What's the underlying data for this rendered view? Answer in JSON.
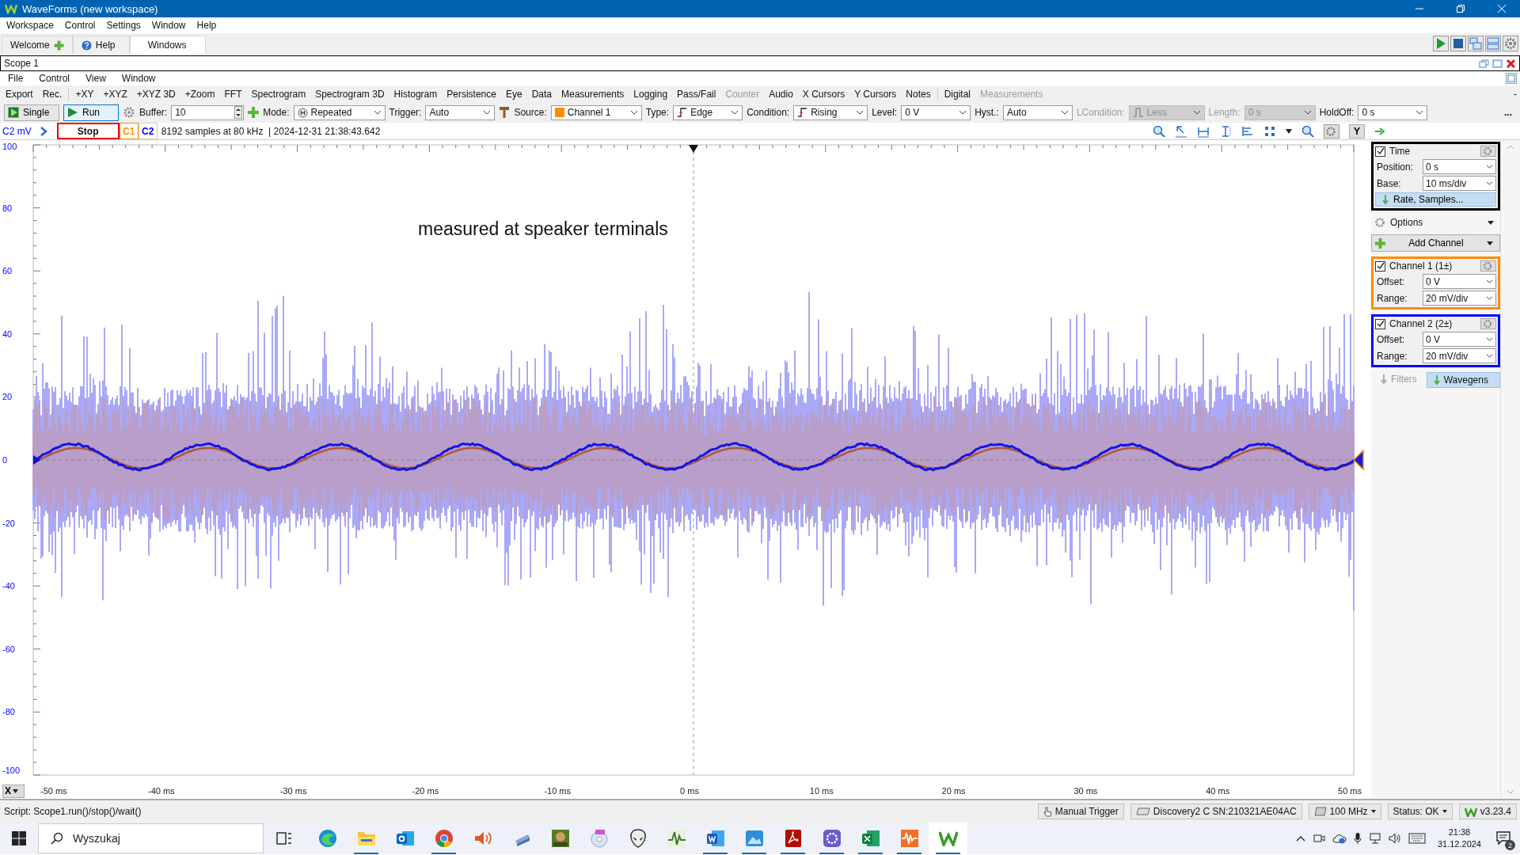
{
  "window": {
    "title": "WaveForms (new workspace)"
  },
  "menu": [
    "Workspace",
    "Control",
    "Settings",
    "Window",
    "Help"
  ],
  "tabs": [
    {
      "label": "Welcome",
      "selected": false
    },
    {
      "label": "Help",
      "selected": false
    },
    {
      "label": "Windows",
      "selected": true
    }
  ],
  "scope": {
    "title": "Scope 1",
    "menu": [
      "File",
      "Control",
      "View",
      "Window"
    ],
    "toolbar": [
      [
        {
          "label": "Export",
          "disabled": false
        },
        {
          "label": "Rec.",
          "disabled": false
        }
      ],
      [
        {
          "label": "+XY",
          "disabled": false
        },
        {
          "label": "+XYZ",
          "disabled": false
        },
        {
          "label": "+XYZ 3D",
          "disabled": false
        },
        {
          "label": "+Zoom",
          "disabled": false
        },
        {
          "label": "FFT",
          "disabled": false
        },
        {
          "label": "Spectrogram",
          "disabled": false
        },
        {
          "label": "Spectrogram 3D",
          "disabled": false
        },
        {
          "label": "Histogram",
          "disabled": false
        },
        {
          "label": "Persistence",
          "disabled": false
        },
        {
          "label": "Eye",
          "disabled": false
        },
        {
          "label": "Data",
          "disabled": false
        },
        {
          "label": "Measurements",
          "disabled": false
        },
        {
          "label": "Logging",
          "disabled": false
        },
        {
          "label": "Pass/Fail",
          "disabled": false
        },
        {
          "label": "Counter",
          "disabled": true
        },
        {
          "label": "Audio",
          "disabled": false
        },
        {
          "label": "X Cursors",
          "disabled": false
        },
        {
          "label": "Y Cursors",
          "disabled": false
        },
        {
          "label": "Notes",
          "disabled": false
        }
      ],
      [
        {
          "label": "Digital",
          "disabled": false
        },
        {
          "label": "Measurements",
          "disabled": true
        }
      ]
    ],
    "toolbar_collapse": "-",
    "trigger_bar": [
      {
        "kind": "button",
        "label": "Single",
        "selected": false
      },
      {
        "kind": "button",
        "label": "Run",
        "selected": true
      },
      {
        "kind": "spin",
        "label": "Buffer:",
        "value": "10"
      },
      {
        "kind": "select",
        "label": "Mode:",
        "value": "Repeated",
        "disabled": false
      },
      {
        "kind": "select",
        "label": "Trigger:",
        "value": "Auto",
        "disabled": false
      },
      {
        "kind": "select",
        "label": "Source:",
        "value": "Channel 1",
        "disabled": false
      },
      {
        "kind": "select",
        "label": "Type:",
        "value": "Edge",
        "disabled": false
      },
      {
        "kind": "select",
        "label": "Condition:",
        "value": "Rising",
        "disabled": false
      },
      {
        "kind": "select",
        "label": "Level:",
        "value": "0 V",
        "disabled": false
      },
      {
        "kind": "select",
        "label": "Hyst.:",
        "value": "Auto",
        "disabled": false
      },
      {
        "kind": "select",
        "label": "LCondition:",
        "value": "Less",
        "disabled": true
      },
      {
        "kind": "select",
        "label": "Length:",
        "value": "0 s",
        "disabled": true
      },
      {
        "kind": "select",
        "label": "HoldOff:",
        "value": "0 s",
        "disabled": false
      },
      {
        "kind": "more",
        "label": "..."
      }
    ],
    "info": {
      "unit": "C2 mV",
      "state": "Stop",
      "channels": [
        {
          "label": "C1",
          "color": "#ff8c00"
        },
        {
          "label": "C2",
          "color": "#0000ff"
        }
      ],
      "summary": "8192 samples at 80 kHz  | 2024-12-31 21:38:43.642",
      "y_button": "Y"
    },
    "plot": {
      "annotation": "measured at speaker terminals",
      "y_labels": [
        "100",
        "80",
        "60",
        "40",
        "20",
        "0",
        "-20",
        "-40",
        "-60",
        "-80",
        "-100"
      ],
      "x_button": "X",
      "x_labels": [
        "-50 ms",
        "-40 ms",
        "-30 ms",
        "-20 ms",
        "-10 ms",
        "0 ms",
        "10 ms",
        "20 ms",
        "30 ms",
        "40 ms",
        "50 ms"
      ]
    }
  },
  "panel": {
    "time": {
      "label": "Time",
      "checked": true,
      "position_label": "Position:",
      "position": "0 s",
      "base_label": "Base:",
      "base": "10 ms/div",
      "rate_button": "Rate, Samples..."
    },
    "options": "Options",
    "add_channel": "Add Channel",
    "channels": [
      {
        "name": "Channel 1 (1±)",
        "checked": true,
        "color": "#ff8c00",
        "offset_label": "Offset:",
        "offset": "0 V",
        "range_label": "Range:",
        "range": "20 mV/div"
      },
      {
        "name": "Channel 2 (2±)",
        "checked": true,
        "color": "#0000ff",
        "offset_label": "Offset:",
        "offset": "0 V",
        "range_label": "Range:",
        "range": "20 mV/div"
      }
    ],
    "bottom_tabs": [
      {
        "label": "Filters",
        "disabled": true,
        "selected": false
      },
      {
        "label": "Wavegens",
        "disabled": false,
        "selected": true
      }
    ]
  },
  "status_bar": {
    "script": "Script: Scope1.run()/stop()/wait()",
    "items": [
      "Manual Trigger",
      "Discovery2 C SN:210321AE04AC",
      "100 MHz",
      "Status: OK",
      "v3.23.4"
    ]
  },
  "taskbar": {
    "search": {
      "placeholder": "Wyszukaj"
    },
    "apps": [
      {
        "kind": "edge",
        "running": false,
        "selected": false
      },
      {
        "kind": "folder",
        "running": true,
        "selected": false
      },
      {
        "kind": "mail",
        "running": false,
        "selected": false
      },
      {
        "kind": "globe",
        "running": true,
        "selected": false
      },
      {
        "kind": "speaker",
        "running": false,
        "selected": false
      },
      {
        "kind": "scanner",
        "running": false,
        "selected": false
      },
      {
        "kind": "game",
        "running": false,
        "selected": false
      },
      {
        "kind": "disc",
        "running": false,
        "selected": false
      },
      {
        "kind": "alien",
        "running": false,
        "selected": false
      },
      {
        "kind": "pulse",
        "running": false,
        "selected": false
      },
      {
        "kind": "word",
        "running": true,
        "selected": false
      },
      {
        "kind": "photos",
        "running": true,
        "selected": false
      },
      {
        "kind": "pdf",
        "running": true,
        "selected": false
      },
      {
        "kind": "gear",
        "running": true,
        "selected": false
      },
      {
        "kind": "sheet",
        "running": true,
        "selected": false
      },
      {
        "kind": "audio",
        "running": true,
        "selected": false
      },
      {
        "kind": "logo",
        "running": true,
        "selected": true
      }
    ],
    "time": "21:38",
    "date": "31.12.2024",
    "notifications": "2"
  }
}
